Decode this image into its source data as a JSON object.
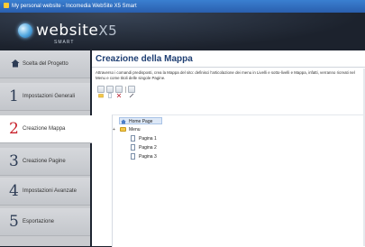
{
  "window": {
    "title": "My personal website - Incomedia WebSite X5 Smart"
  },
  "brand": {
    "name": "website",
    "version_mark": "X5",
    "edition": "SMART"
  },
  "sidebar": {
    "items": [
      {
        "num": "",
        "label": "Scelta del Progetto",
        "icon": "home-icon"
      },
      {
        "num": "1",
        "label": "Impostazioni Generali"
      },
      {
        "num": "2",
        "label": "Creazione Mappa",
        "active": true
      },
      {
        "num": "3",
        "label": "Creazione Pagine"
      },
      {
        "num": "4",
        "label": "Impostazioni Avanzate"
      },
      {
        "num": "5",
        "label": "Esportazione"
      }
    ]
  },
  "main": {
    "title": "Creazione della Mappa",
    "description": "Attraverso i comandi predisposti, crea la Mappa del sito: definisci l'articolazione dei menu in Livelli e sotto-livelli e Mappa, infatti, verranno ricreati nel Menu e come titoli delle singole Pagine.",
    "toolbar": [
      "add-level-icon",
      "add-page-icon",
      "delete-icon",
      "rename-icon"
    ],
    "tree": {
      "home": "Home Page",
      "menu": "Menu",
      "expander": "+",
      "pages": [
        "Pagina 1",
        "Pagina 2",
        "Pagina 3"
      ]
    }
  },
  "colors": {
    "active_number": "#c8202a",
    "title": "#1f3f73",
    "titlebar": "#2a5fae"
  }
}
